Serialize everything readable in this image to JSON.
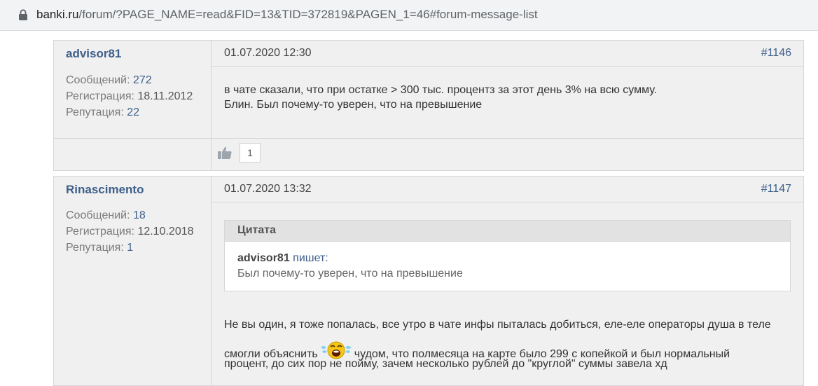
{
  "browser": {
    "url_host": "banki.ru",
    "url_path": "/forum/?PAGE_NAME=read&FID=13&TID=372819&PAGEN_1=46#forum-message-list"
  },
  "posts": [
    {
      "author": "advisor81",
      "stats": {
        "messages_label": "Сообщений:",
        "messages_value": "272",
        "registration_label": "Регистрация:",
        "registration_value": "18.11.2012",
        "reputation_label": "Репутация:",
        "reputation_value": "22"
      },
      "date": "01.07.2020 12:30",
      "number": "#1146",
      "lines": [
        "в чате сказали, что при остатке > 300 тыс. процентз за этот день 3% на всю сумму.",
        "Блин. Был почему-то уверен, что на превышение"
      ],
      "likes": "1"
    },
    {
      "author": "Rinascimento",
      "stats": {
        "messages_label": "Сообщений:",
        "messages_value": "18",
        "registration_label": "Регистрация:",
        "registration_value": "12.10.2018",
        "reputation_label": "Репутация:",
        "reputation_value": "1"
      },
      "date": "01.07.2020 13:32",
      "number": "#1147",
      "quote": {
        "title": "Цитата",
        "author": "advisor81",
        "writes": "пишет:",
        "text": "Был почему-то уверен, что на превышение"
      },
      "lines": [
        "Не вы один, я тоже попалась, все утро в чате инфы пыталась добиться, еле-еле операторы душа в теле",
        "смогли объяснить",
        "чудом, что полмесяца на карте было 299 с копейкой и был нормальный",
        "процент, до сих пор не пойму, зачем несколько рублей до \"круглой\" суммы завела хд"
      ]
    }
  ],
  "icons": {
    "lock": "lock-icon",
    "like": "thumbs-up-icon",
    "smiley": "crying-laughing-smiley-icon"
  }
}
